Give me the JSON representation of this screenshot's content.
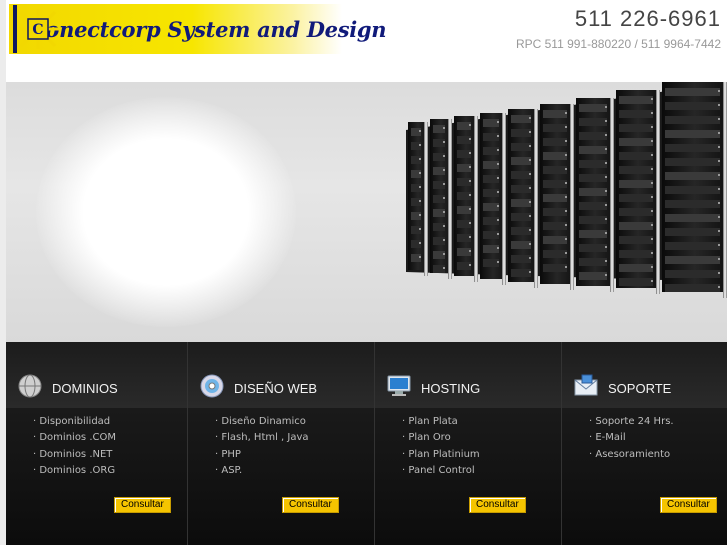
{
  "header": {
    "logo_text": "Conectcorp System and Design",
    "phone": "511 226-6961",
    "rpc": "RPC 511 991-880220 / 511 9964-7442"
  },
  "sections": [
    {
      "title": "DOMINIOS",
      "icon": "globe-icon",
      "items": [
        "Disponibilidad",
        "Dominios .COM",
        "Dominios .NET",
        "Dominios .ORG"
      ],
      "button": "Consultar"
    },
    {
      "title": "DISEÑO WEB",
      "icon": "cd-icon",
      "items": [
        "Diseño Dinamico",
        "Flash, Html , Java",
        "PHP",
        "ASP."
      ],
      "button": "Consultar"
    },
    {
      "title": "HOSTING",
      "icon": "monitor-icon",
      "items": [
        "Plan Plata",
        "Plan Oro",
        "Plan Platinium",
        "Panel Control"
      ],
      "button": "Consultar"
    },
    {
      "title": "SOPORTE",
      "icon": "mail-icon",
      "items": [
        "Soporte 24 Hrs.",
        "E-Mail",
        "Asesoramiento"
      ],
      "button": "Consultar"
    }
  ],
  "colors": {
    "accent": "#f5c400",
    "logo_bg": "#f2d800",
    "logo_text": "#101a7a",
    "panel_bg": "#0e0e0e"
  }
}
